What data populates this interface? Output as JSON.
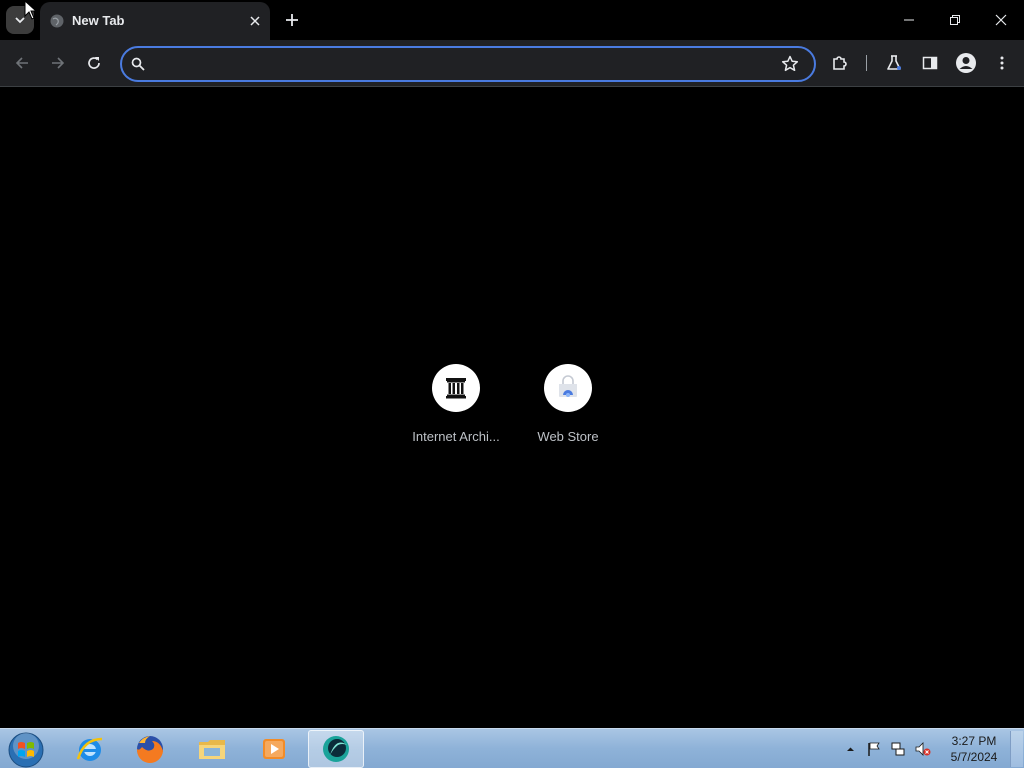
{
  "browser": {
    "tab": {
      "title": "New Tab"
    },
    "omnibox": {
      "value": "",
      "placeholder": ""
    }
  },
  "new_tab_page": {
    "shortcuts": [
      {
        "label": "Internet Archi...",
        "icon": "internet-archive-icon"
      },
      {
        "label": "Web Store",
        "icon": "web-store-icon"
      }
    ]
  },
  "taskbar": {
    "apps": [
      "internet-explorer",
      "firefox",
      "windows-explorer",
      "media-player",
      "chrome-beta"
    ],
    "clock": {
      "time": "3:27 PM",
      "date": "5/7/2024"
    }
  },
  "colors": {
    "accent": "#4a7be0",
    "toolbar_bg": "#202124",
    "page_bg": "#000000",
    "taskbar": "#8eb2d8"
  }
}
